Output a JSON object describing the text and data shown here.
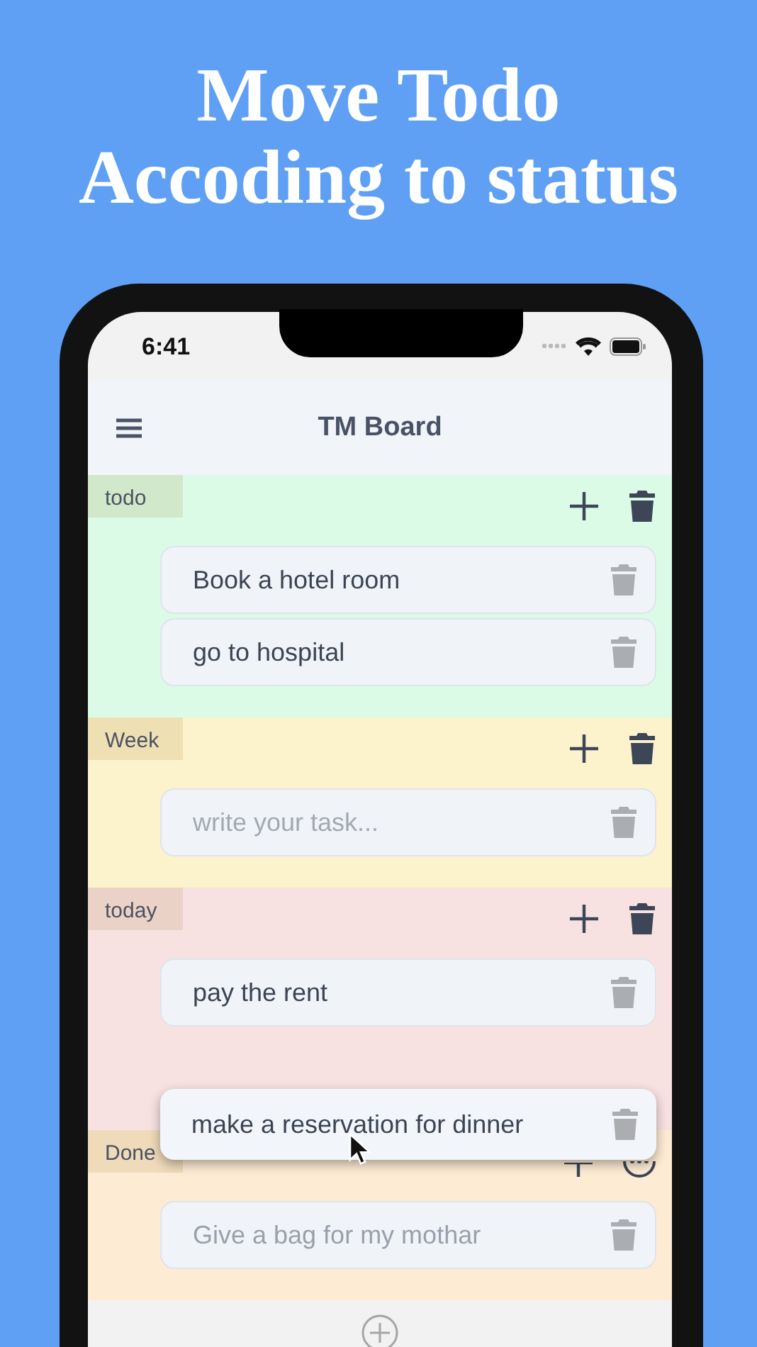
{
  "headline": [
    "Move Todo",
    "Accoding to status"
  ],
  "status_bar": {
    "time": "6:41"
  },
  "app_bar": {
    "title": "TM Board"
  },
  "sections": [
    {
      "name": "todo",
      "color": "#dcfbe6",
      "more_menu": false,
      "drop_slot": false,
      "cards": [
        {
          "kind": "task",
          "text": "Book a hotel room",
          "done": false
        },
        {
          "kind": "task",
          "text": "go to hospital",
          "done": false
        }
      ]
    },
    {
      "name": "Week",
      "color": "#fcf2cb",
      "more_menu": false,
      "drop_slot": false,
      "cards": [
        {
          "kind": "input",
          "placeholder": "write your task..."
        }
      ]
    },
    {
      "name": "today",
      "color": "#f8e2e1",
      "more_menu": false,
      "drop_slot": true,
      "cards": [
        {
          "kind": "task",
          "text": "pay the rent",
          "done": false
        }
      ]
    },
    {
      "name": "Done",
      "color": "#fdebd3",
      "more_menu": true,
      "drop_slot": false,
      "cards": [
        {
          "kind": "task",
          "text": "Give a bag for my mothar",
          "done": true
        }
      ]
    }
  ],
  "dragged_card": {
    "text": "make a reservation for dinner"
  }
}
